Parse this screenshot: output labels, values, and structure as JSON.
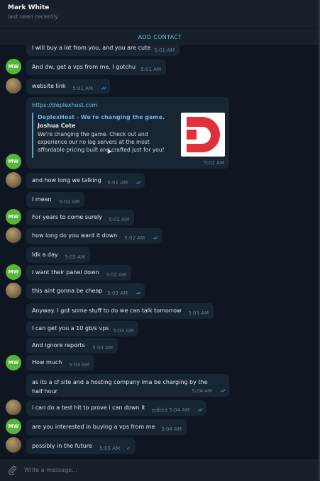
{
  "header": {
    "title": "Mark White",
    "status": "last seen recently"
  },
  "add_contact_label": "ADD CONTACT",
  "avatar_initials": "MW",
  "messages": [
    {
      "text": "I will buy a lot from you, and you are cute",
      "time": "5:01 AM",
      "sender": "contact"
    },
    {
      "text": "And dw, get a vps from me. I gotchu",
      "time": "5:01 AM",
      "sender": "contact"
    },
    {
      "text": "website link",
      "time": "5:01 AM",
      "sender": "me",
      "read": true
    },
    {
      "text": "and how long we talking",
      "time": "5:01 AM",
      "sender": "me",
      "read": true
    },
    {
      "text": "I mean",
      "time": "5:02 AM",
      "sender": "me"
    },
    {
      "text": "For years to come surely",
      "time": "5:02 AM",
      "sender": "contact"
    },
    {
      "text": "how long do you want it down",
      "time": "5:02 AM",
      "sender": "me",
      "read": true
    },
    {
      "text": "Idk a day",
      "time": "5:02 AM",
      "sender": "contact"
    },
    {
      "text": "I want their panel down",
      "time": "5:02 AM",
      "sender": "contact"
    },
    {
      "text": "this aint gonna be cheap",
      "time": "5:03 AM",
      "sender": "me",
      "read": true
    },
    {
      "text": "Anyway. I got some stuff to do we can talk tomorrow",
      "time": "5:03 AM",
      "sender": "me"
    },
    {
      "text": "I can get you a 10 gb/s vps",
      "time": "5:03 AM",
      "sender": "me"
    },
    {
      "text": "And ignore reports",
      "time": "5:03 AM",
      "sender": "me"
    },
    {
      "text": "How much",
      "time": "5:03 AM",
      "sender": "contact"
    },
    {
      "text": "as its a cf site and a hosting company ima be charging by the half hour",
      "time": "5:04 AM",
      "sender": "me",
      "read": true
    },
    {
      "text": "i can do a test hit to prove i can down it",
      "time": "edited 5:04 AM",
      "sender": "me",
      "read": true
    },
    {
      "text": "are you interested in buying a vps from me",
      "time": "5:04 AM",
      "sender": "contact"
    },
    {
      "text": "possibly in the future",
      "time": "5:05 AM",
      "sender": "me",
      "read": true
    }
  ],
  "link_message": {
    "url": "https://deplexhost.com",
    "time": "5:01 AM",
    "preview": {
      "site": "DeplexHost - We're changing the game.",
      "title": "Joshua Cote",
      "description": "We're changing the game. Check out and experience our no lag servers at the most affordable pricing built and crafted just for you!"
    }
  },
  "composer": {
    "placeholder": "Write a message..."
  },
  "colors": {
    "incoming_bubble": "#182533",
    "background": "#0e1621",
    "accent": "#5fbfd6",
    "logo_red": "#e0313a"
  },
  "icons": [
    "paperclip-icon",
    "double-check-icon",
    "single-check-icon"
  ]
}
